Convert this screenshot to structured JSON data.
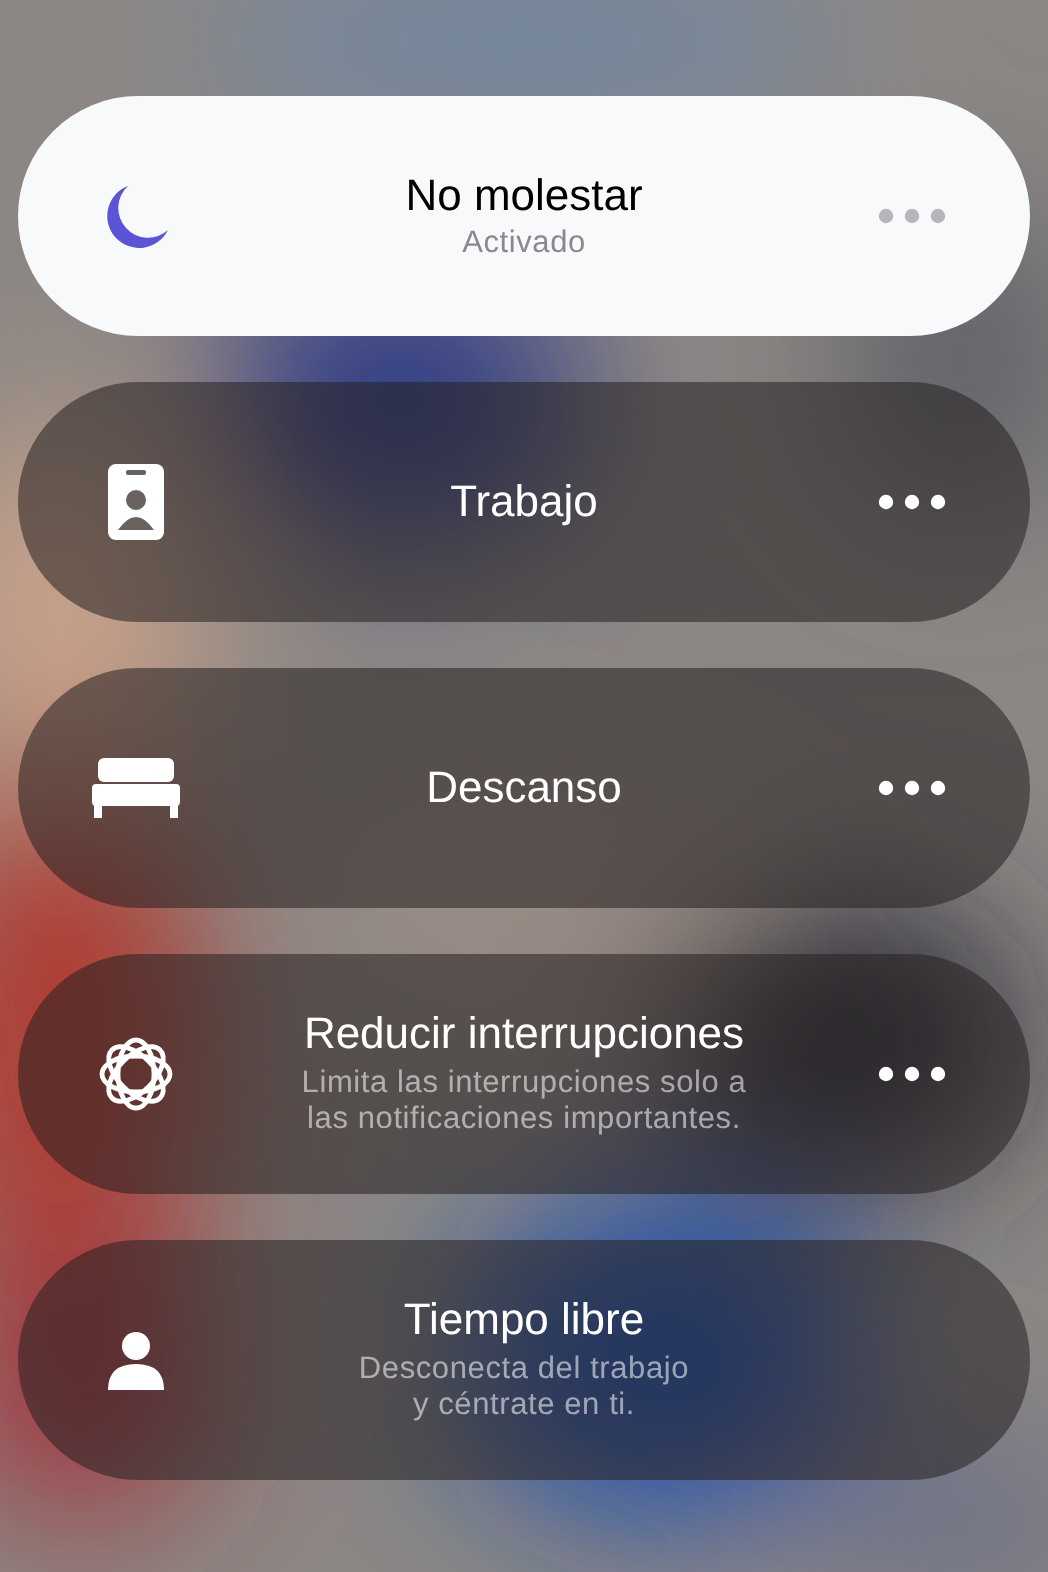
{
  "focus_modes": [
    {
      "title": "No molestar",
      "subtitle": "Activado",
      "selected": true,
      "has_more": true
    },
    {
      "title": "Trabajo",
      "selected": false,
      "has_more": true
    },
    {
      "title": "Descanso",
      "selected": false,
      "has_more": true
    },
    {
      "title": "Reducir interrupciones",
      "subtitle": "Limita las interrupciones solo a las notificaciones importantes.",
      "selected": false,
      "has_more": true
    },
    {
      "title": "Tiempo libre",
      "subtitle": "Desconecta del trabajo y céntrate en ti.",
      "selected": false,
      "has_more": false
    }
  ]
}
